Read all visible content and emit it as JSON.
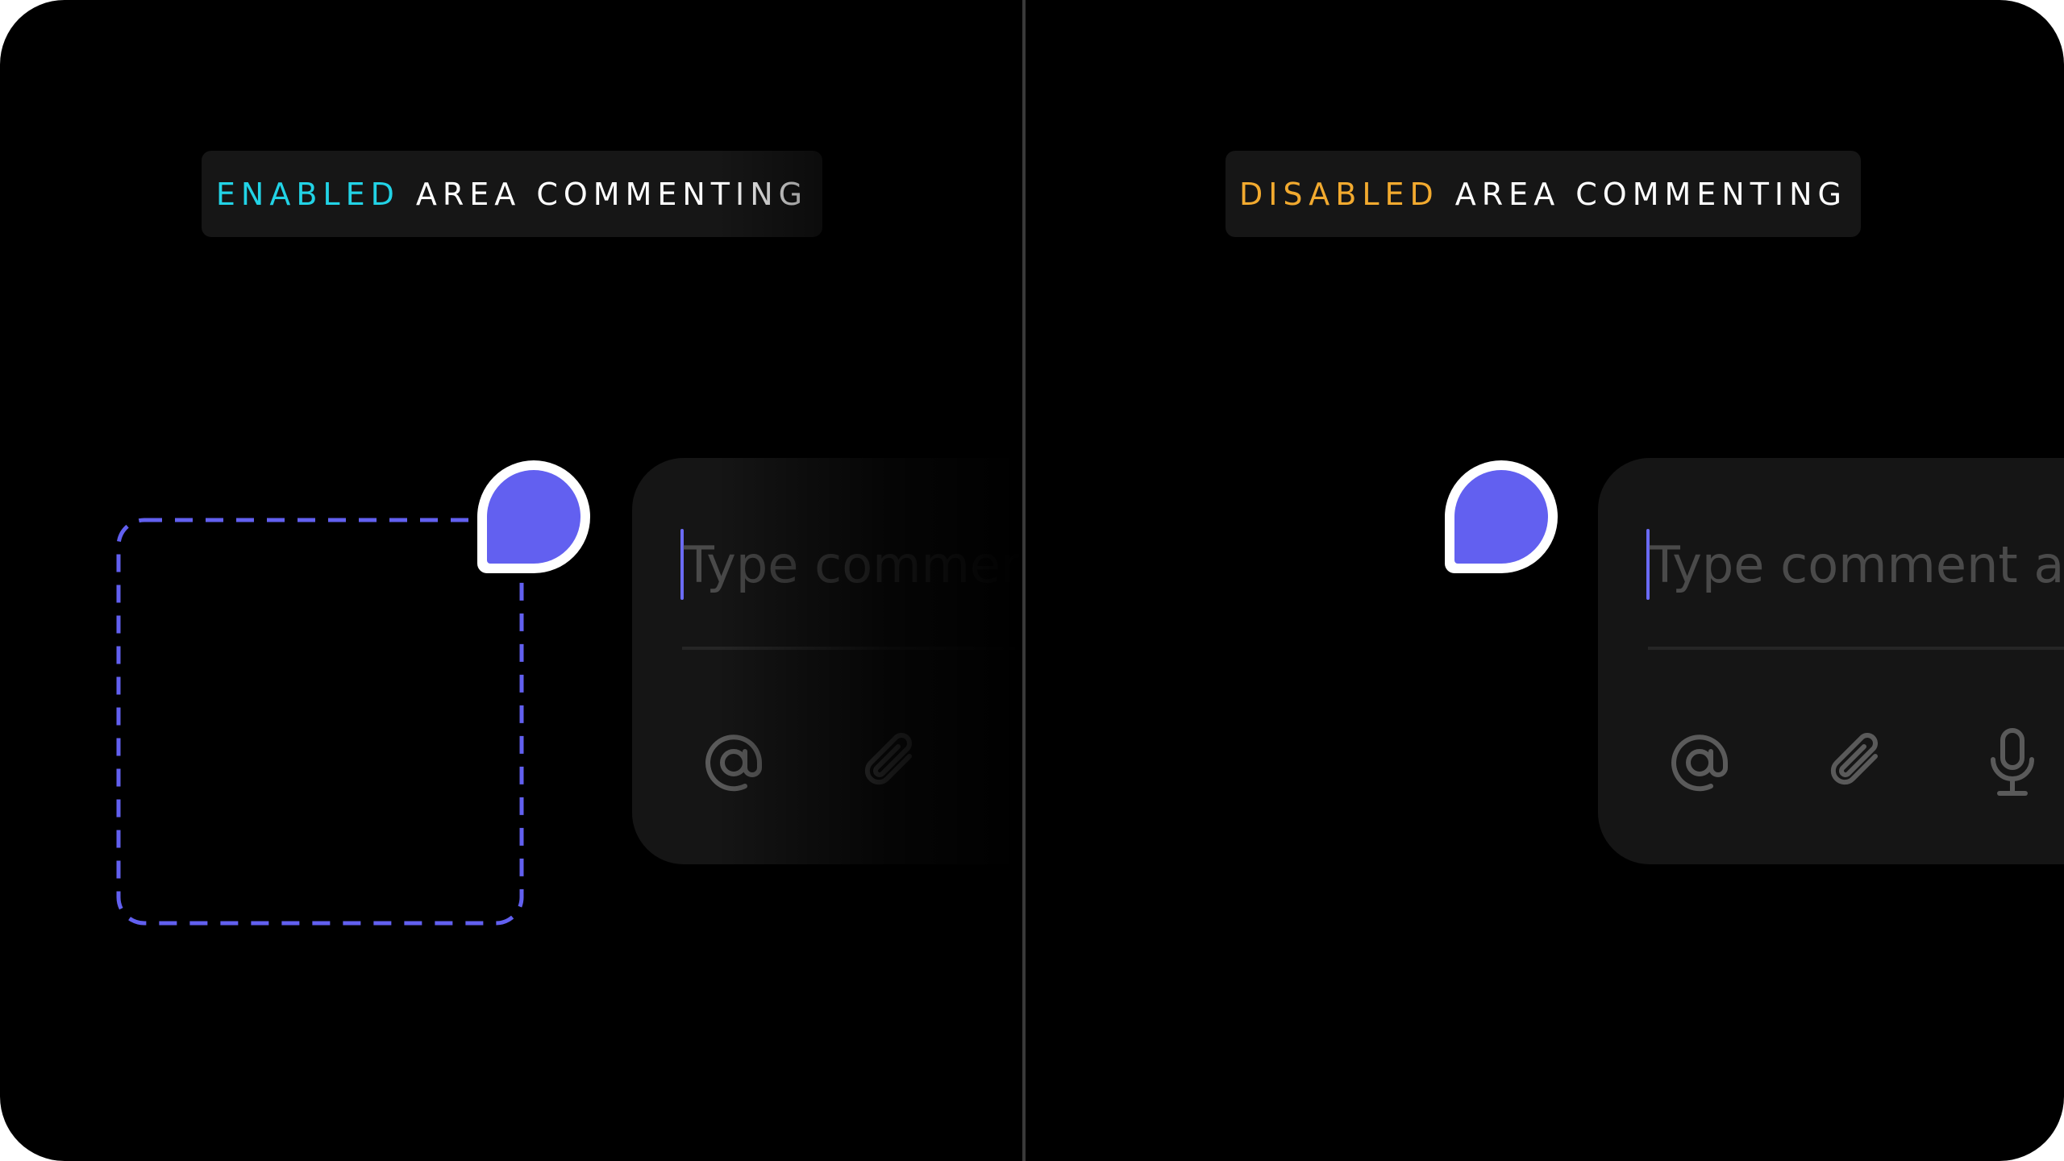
{
  "left_panel": {
    "label_accent": "ENABLED",
    "label_rest": "AREA COMMENTING",
    "accent_color": "#22d3e6",
    "comment_placeholder": "Type comment",
    "tools": [
      "at-sign-icon",
      "paperclip-icon"
    ]
  },
  "right_panel": {
    "label_accent": "DISABLED",
    "label_rest": "AREA COMMENTING",
    "accent_color": "#f2aa2f",
    "comment_placeholder": "Type comment a",
    "tools": [
      "at-sign-icon",
      "paperclip-icon",
      "microphone-icon"
    ]
  },
  "colors": {
    "background": "#000000",
    "pin": "#6260f0",
    "area_outline": "#6260f0",
    "card": "#151515"
  }
}
